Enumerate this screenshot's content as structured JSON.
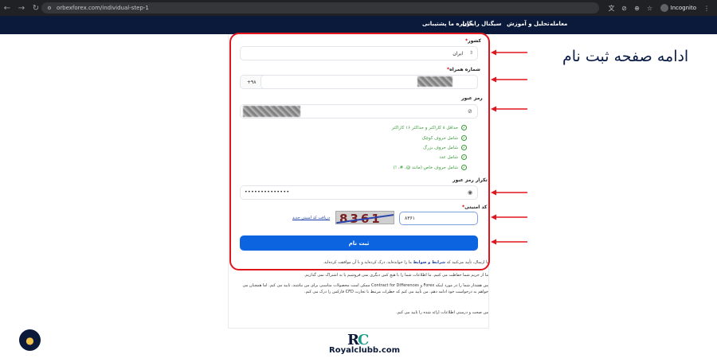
{
  "browser": {
    "url": "orbexforex.com/individual-step-1",
    "incognito_label": "Incognito"
  },
  "topnav": {
    "links": [
      "معامله",
      "تحلیل و آموزش",
      "سیگنال رایگان",
      "درباره ما",
      "پشتیبانی"
    ]
  },
  "form": {
    "country_label": "کشور",
    "country_value": "ایران",
    "phone_label": "شماره همراه",
    "phone_prefix": "+۹۸",
    "password_label": "رمز عبور",
    "password_rules": [
      "حداقل ۸ کاراکتر و حداکثر ۱۶ کاراکتر",
      "شامل حروف کوچک",
      "شامل حروف بزرگ",
      "شامل عدد",
      "شامل حروف خاص (مانند @، #، !)"
    ],
    "confirm_label": "تکرار رمز عبور",
    "confirm_value": "••••••••••••••",
    "captcha_label": "کد امنیتی",
    "captcha_input_value": "۸۳۶۱",
    "captcha_image_text": "8361",
    "captcha_refresh_link": "دریافت کد امنیتی جدید",
    "submit_label": "ثبت نام",
    "terms_prefix": "با ارسال، تأیید می‌کنید که",
    "terms_link": "شرایط و ضوابط",
    "terms_suffix": "ما را خوانده‌اید، درک کرده‌اید و با آن موافقت کرده‌اید.",
    "privacy_text": "ما از حریم شما حفاظت می کنیم. ما اطلاعات شما را با هیچ کس دیگری نمی فروشیم یا به اشتراک نمی گذاریم.",
    "risk_text": "من هشدار شما را در مورد اینکه Forex و Contract for Differences ممکن است محصولات مناسبی برای من نباشند، تایید می کنم. اما همچنان می خواهم به درخواست خود ادامه دهم. من تأیید می کنم که خطرات مرتبط با تجارت CFD فارکس را درک می کنم.",
    "accuracy_text": "من صحت و درستی اطلاعات ارائه شده را تایید می کنم."
  },
  "annotation": {
    "caption": "ادامه صفحه ثبت نام",
    "highlight_color": "#e0161e"
  },
  "watermark": {
    "logo_text": "Royalclubb.com",
    "logo_mark": "RC"
  },
  "colors": {
    "nav_bg": "#0b1a3a",
    "submit_bg": "#0d64e0",
    "rule_green": "#3a9a3a"
  }
}
